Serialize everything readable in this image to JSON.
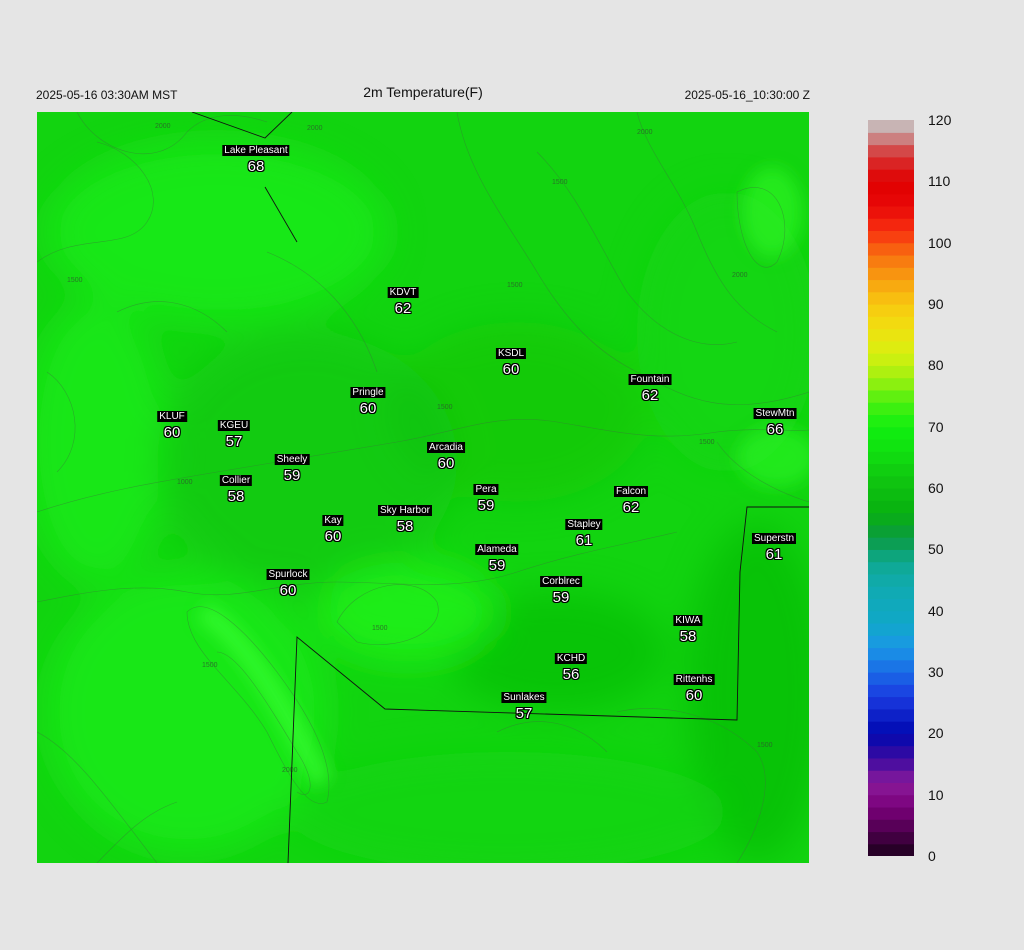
{
  "header": {
    "local_time": "2025-05-16 03:30AM MST",
    "title": "2m Temperature(F)",
    "utc_time": "2025-05-16_10:30:00 Z"
  },
  "colorbar": {
    "min": 0,
    "max": 120,
    "ticks": [
      "120",
      "110",
      "100",
      "90",
      "80",
      "70",
      "60",
      "50",
      "40",
      "30",
      "20",
      "10",
      "0"
    ]
  },
  "contour_labels": [
    "2000",
    "2000",
    "1500",
    "1500",
    "1500",
    "2000",
    "1500",
    "1500",
    "1000",
    "2000",
    "2000",
    "1500",
    "1500",
    "1500"
  ],
  "stations": [
    {
      "name": "Lake Pleasant",
      "value": "68"
    },
    {
      "name": "KDVT",
      "value": "62"
    },
    {
      "name": "KSDL",
      "value": "60"
    },
    {
      "name": "Fountain",
      "value": "62"
    },
    {
      "name": "Pringle",
      "value": "60"
    },
    {
      "name": "KLUF",
      "value": "60"
    },
    {
      "name": "KGEU",
      "value": "57"
    },
    {
      "name": "StewMtn",
      "value": "66"
    },
    {
      "name": "Sheely",
      "value": "59"
    },
    {
      "name": "Arcadia",
      "value": "60"
    },
    {
      "name": "Collier",
      "value": "58"
    },
    {
      "name": "Pera",
      "value": "59"
    },
    {
      "name": "Falcon",
      "value": "62"
    },
    {
      "name": "Kay",
      "value": "60"
    },
    {
      "name": "Sky Harbor",
      "value": "58"
    },
    {
      "name": "Stapley",
      "value": "61"
    },
    {
      "name": "Superstn",
      "value": "61"
    },
    {
      "name": "Alameda",
      "value": "59"
    },
    {
      "name": "Spurlock",
      "value": "60"
    },
    {
      "name": "Corblrec",
      "value": "59"
    },
    {
      "name": "KIWA",
      "value": "58"
    },
    {
      "name": "KCHD",
      "value": "56"
    },
    {
      "name": "Rittenhs",
      "value": "60"
    },
    {
      "name": "Sunlakes",
      "value": "57"
    }
  ]
}
